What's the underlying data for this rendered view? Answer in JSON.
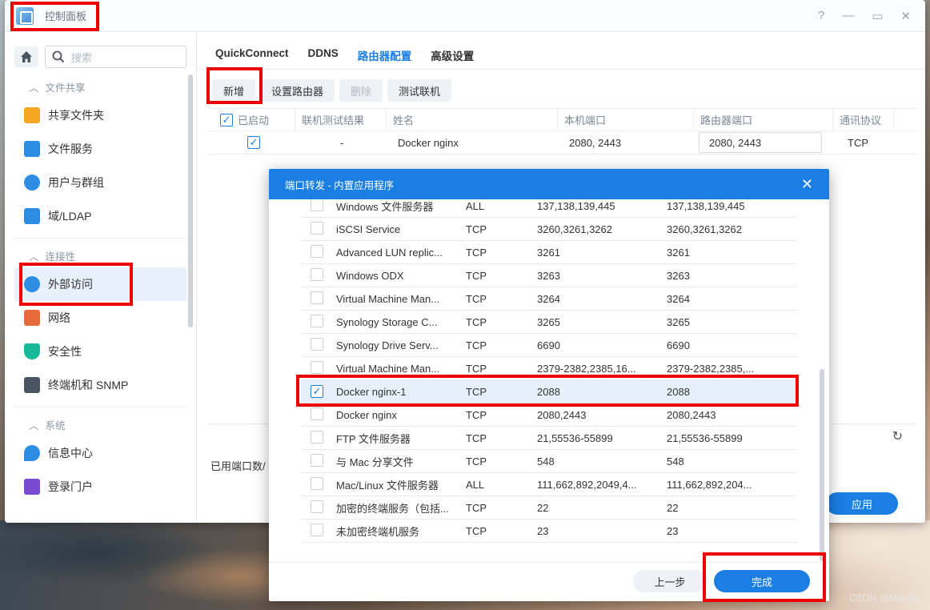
{
  "window": {
    "title": "控制面板",
    "controls": [
      "?",
      "—",
      "▭",
      "✕"
    ]
  },
  "sidebar": {
    "search_placeholder": "搜索",
    "sections": [
      {
        "label": "文件共享",
        "items": [
          {
            "label": "共享文件夹",
            "icon": "folder-icon",
            "color": "#f5a623"
          },
          {
            "label": "文件服务",
            "icon": "file-service-icon",
            "color": "#2d8de3"
          },
          {
            "label": "用户与群组",
            "icon": "users-icon",
            "color": "#2d8de3"
          },
          {
            "label": "域/LDAP",
            "icon": "ldap-icon",
            "color": "#2d8de3"
          }
        ]
      },
      {
        "label": "连接性",
        "items": [
          {
            "label": "外部访问",
            "icon": "external-access-icon",
            "color": "#2d8de3"
          },
          {
            "label": "网络",
            "icon": "network-icon",
            "color": "#e86b3c"
          },
          {
            "label": "安全性",
            "icon": "shield-icon",
            "color": "#18b89a"
          },
          {
            "label": "终端机和 SNMP",
            "icon": "terminal-icon",
            "color": "#4a5563"
          }
        ]
      },
      {
        "label": "系统",
        "items": [
          {
            "label": "信息中心",
            "icon": "info-icon",
            "color": "#2d8de3"
          },
          {
            "label": "登录门户",
            "icon": "portal-icon",
            "color": "#7a4bd0"
          }
        ]
      }
    ]
  },
  "tabs": [
    "QuickConnect",
    "DDNS",
    "路由器配置",
    "高级设置"
  ],
  "toolbar": {
    "add": "新增",
    "setup_router": "设置路由器",
    "delete": "删除",
    "test": "测试联机"
  },
  "grid": {
    "headers": [
      "已启动",
      "联机测试结果",
      "姓名",
      "本机端口",
      "路由器端口",
      "通讯协议"
    ],
    "rows": [
      {
        "enabled": true,
        "test": "-",
        "name": "Docker nginx",
        "local": "2080, 2443",
        "router": "2080, 2443",
        "protocol": "TCP"
      }
    ]
  },
  "footer": {
    "used_ports": "已用端口数/",
    "apply": "应用"
  },
  "dialog": {
    "title": "端口转发 - 内置应用程序",
    "rows": [
      {
        "checked": false,
        "name": "Windows 文件服务器",
        "protocol": "ALL",
        "local": "137,138,139,445",
        "router": "137,138,139,445"
      },
      {
        "checked": false,
        "name": "iSCSI Service",
        "protocol": "TCP",
        "local": "3260,3261,3262",
        "router": "3260,3261,3262"
      },
      {
        "checked": false,
        "name": "Advanced LUN replic...",
        "protocol": "TCP",
        "local": "3261",
        "router": "3261"
      },
      {
        "checked": false,
        "name": "Windows ODX",
        "protocol": "TCP",
        "local": "3263",
        "router": "3263"
      },
      {
        "checked": false,
        "name": "Virtual Machine Man...",
        "protocol": "TCP",
        "local": "3264",
        "router": "3264"
      },
      {
        "checked": false,
        "name": "Synology Storage C...",
        "protocol": "TCP",
        "local": "3265",
        "router": "3265"
      },
      {
        "checked": false,
        "name": "Synology Drive Serv...",
        "protocol": "TCP",
        "local": "6690",
        "router": "6690"
      },
      {
        "checked": false,
        "name": "Virtual Machine Man...",
        "protocol": "TCP",
        "local": "2379-2382,2385,16...",
        "router": "2379-2382,2385,..."
      },
      {
        "checked": true,
        "name": "Docker nginx-1",
        "protocol": "TCP",
        "local": "2088",
        "router": "2088"
      },
      {
        "checked": false,
        "name": "Docker nginx",
        "protocol": "TCP",
        "local": "2080,2443",
        "router": "2080,2443"
      },
      {
        "checked": false,
        "name": "FTP 文件服务器",
        "protocol": "TCP",
        "local": "21,55536-55899",
        "router": "21,55536-55899"
      },
      {
        "checked": false,
        "name": "与 Mac 分享文件",
        "protocol": "TCP",
        "local": "548",
        "router": "548"
      },
      {
        "checked": false,
        "name": "Mac/Linux 文件服务器",
        "protocol": "ALL",
        "local": "111,662,892,2049,4...",
        "router": "111,662,892,204..."
      },
      {
        "checked": false,
        "name": "加密的终端服务（包括...",
        "protocol": "TCP",
        "local": "22",
        "router": "22"
      },
      {
        "checked": false,
        "name": "未加密终端机服务",
        "protocol": "TCP",
        "local": "23",
        "router": "23"
      }
    ],
    "prev": "上一步",
    "done": "完成"
  },
  "watermark": "CSDN @MilletO"
}
